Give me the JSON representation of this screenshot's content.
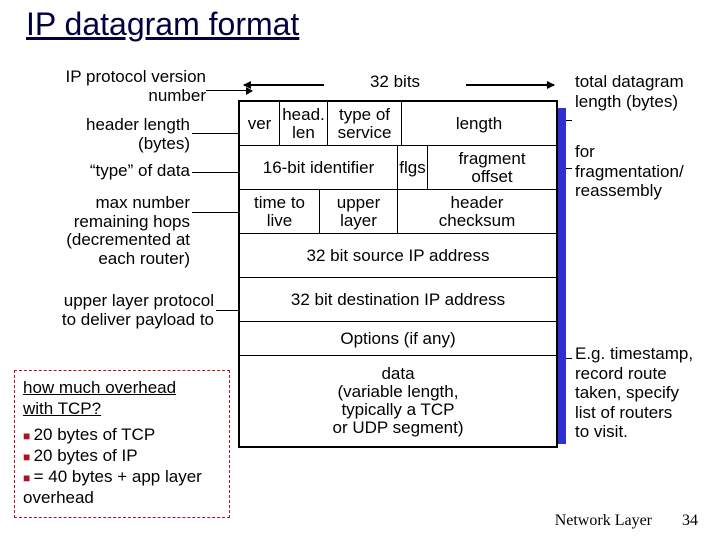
{
  "title": "IP datagram format",
  "bits_label": "32 bits",
  "left": {
    "version": "IP protocol version\nnumber",
    "hlen": "header length\n(bytes)",
    "tos": "“type” of data",
    "ttl": "max number\nremaining hops\n(decremented at\neach router)",
    "proto": "upper layer protocol\nto deliver payload to"
  },
  "right": {
    "totlen": "total datagram\nlength (bytes)",
    "frag": "for\nfragmentation/\nreassembly",
    "options": "E.g. timestamp,\nrecord route\ntaken, specify\nlist of routers\nto visit."
  },
  "cells": {
    "ver": "ver",
    "hlen": "head.\nlen",
    "tos": "type of\nservice",
    "length": "length",
    "id": "16-bit identifier",
    "flgs": "flgs",
    "fragoff": "fragment\noffset",
    "ttl": "time to\nlive",
    "proto": "upper\nlayer",
    "chk": "header\nchecksum",
    "src": "32 bit source IP address",
    "dst": "32 bit destination IP address",
    "opts": "Options (if any)",
    "data": "data\n(variable length,\ntypically a TCP\nor UDP segment)"
  },
  "overhead": {
    "question": "how much overhead\nwith TCP?",
    "items": [
      "20 bytes of TCP",
      "20 bytes of IP",
      "= 40 bytes + app layer overhead"
    ]
  },
  "footer": {
    "section": "Network Layer",
    "page": "34"
  }
}
